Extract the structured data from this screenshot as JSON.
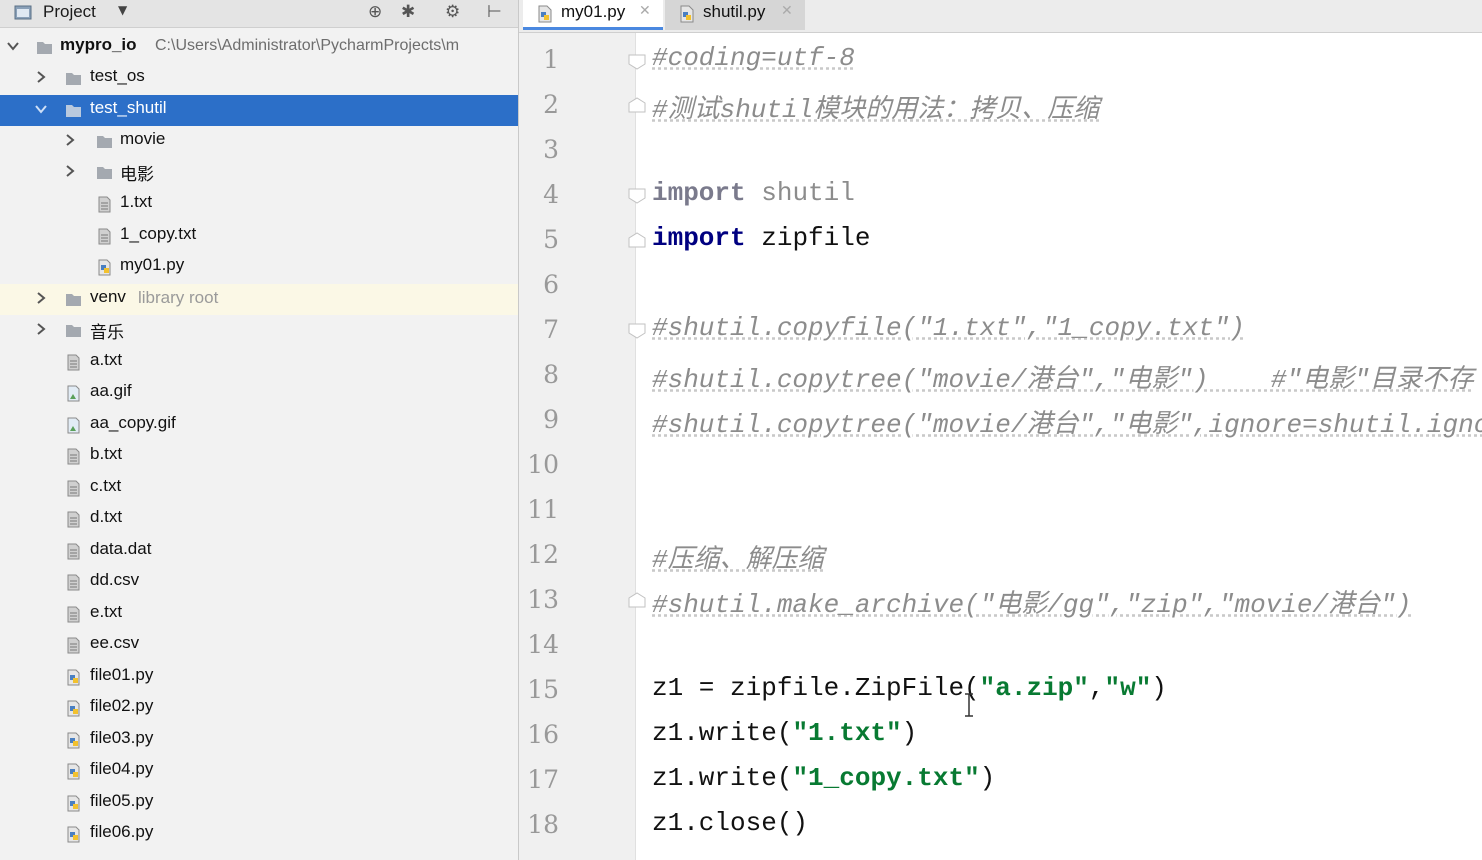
{
  "project_panel": {
    "title": "Project",
    "icons": [
      "project-icon",
      "dropdown-icon",
      "locate-icon",
      "collapse-icon",
      "settings-icon",
      "hide-icon"
    ]
  },
  "tree": {
    "root": {
      "name": "mypro_io",
      "path": "C:\\Users\\Administrator\\PycharmProjects\\m"
    },
    "test_os": "test_os",
    "test_shutil": "test_shutil",
    "movie": "movie",
    "dianying": "电影",
    "f_1txt": "1.txt",
    "f_1copy": "1_copy.txt",
    "f_my01": "my01.py",
    "venv": "venv",
    "venv_note": "library root",
    "yinyue": "音乐",
    "root_files": [
      "a.txt",
      "aa.gif",
      "aa_copy.gif",
      "b.txt",
      "c.txt",
      "d.txt",
      "data.dat",
      "dd.csv",
      "e.txt",
      "ee.csv",
      "file01.py",
      "file02.py",
      "file03.py",
      "file04.py",
      "file05.py",
      "file06.py"
    ]
  },
  "tabs": [
    {
      "label": "my01.py",
      "active": true
    },
    {
      "label": "shutil.py",
      "active": false
    }
  ],
  "editor": {
    "line_numbers": [
      "1",
      "2",
      "3",
      "4",
      "5",
      "6",
      "7",
      "8",
      "9",
      "10",
      "11",
      "12",
      "13",
      "14",
      "15",
      "16",
      "17",
      "18"
    ],
    "l1": "#coding=utf-8",
    "l2": "#测试shutil模块的用法：拷贝、压缩",
    "l4_kw": "import",
    "l4_mod": "shutil",
    "l5_kw": "import",
    "l5_mod": "zipfile",
    "l7": "#shutil.copyfile(\"1.txt\",\"1_copy.txt\")",
    "l8": "#shutil.copytree(\"movie/港台\",\"电影\")    #\"电影\"目录不存",
    "l9": "#shutil.copytree(\"movie/港台\",\"电影\",ignore=shutil.igno",
    "l12": "#压缩、解压缩",
    "l13": "#shutil.make_archive(\"电影/gg\",\"zip\",\"movie/港台\")",
    "l15_a": "z1 = zipfile.ZipFile(",
    "l15_s1": "\"a.zip\"",
    "l15_c": ",",
    "l15_s2": "\"w\"",
    "l15_e": ")",
    "l16_a": "z1.write(",
    "l16_s": "\"1.txt\"",
    "l16_e": ")",
    "l17_a": "z1.write(",
    "l17_s": "\"1_copy.txt\"",
    "l17_e": ")",
    "l18": "z1.close()"
  },
  "colors": {
    "selection": "#2c6fc8",
    "keyword": "#000080",
    "string": "#087a32",
    "comment": "#8c8c8c"
  }
}
